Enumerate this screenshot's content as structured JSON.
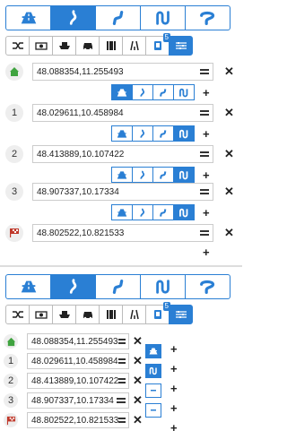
{
  "panel_top": {
    "route_types": [
      {
        "name": "motorway",
        "active": false
      },
      {
        "name": "curvy",
        "active": true
      },
      {
        "name": "curvy-2",
        "active": false
      },
      {
        "name": "extra-curvy",
        "active": false
      },
      {
        "name": "super-curvy",
        "active": false
      }
    ],
    "avoid_options": [
      "shuffle",
      "toll",
      "ferry",
      "car",
      "railway",
      "tunnel",
      "app",
      "settings"
    ],
    "app_badge": "5",
    "waypoints": [
      {
        "marker": "",
        "coords": "48.088354,11.255493"
      },
      {
        "marker": "1",
        "coords": "48.029611,10.458984"
      },
      {
        "marker": "2",
        "coords": "48.413889,10.107422"
      },
      {
        "marker": "3",
        "coords": "48.907337,10.17334"
      },
      {
        "marker": "",
        "coords": "48.802522,10.821533"
      }
    ]
  },
  "panel_bottom": {
    "app_badge": "5",
    "waypoints": [
      {
        "marker": "",
        "coords": "48.088354,11.255493"
      },
      {
        "marker": "1",
        "coords": "48.029611,10.458984"
      },
      {
        "marker": "2",
        "coords": "48.413889,10.107422"
      },
      {
        "marker": "3",
        "coords": "48.907337,10.17334"
      },
      {
        "marker": "",
        "coords": "48.802522,10.821533"
      }
    ]
  },
  "colors": {
    "accent": "#2a7fd4",
    "start": "#3fa33f",
    "finish": "#c0392b"
  }
}
